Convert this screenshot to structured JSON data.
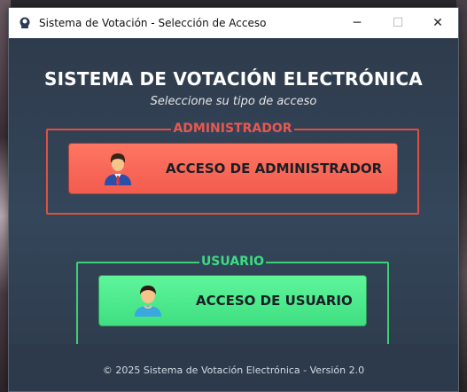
{
  "window": {
    "title": "Sistema de Votación - Selección de Acceso",
    "controls": {
      "minimize": "─",
      "maximize": "☐",
      "close": "✕"
    }
  },
  "header": {
    "title": "SISTEMA DE VOTACIÓN ELECTRÓNICA",
    "subtitle": "Seleccione su tipo de acceso"
  },
  "admin_group": {
    "legend": "ADMINISTRADOR",
    "button_label": "ACCESO DE ADMINISTRADOR",
    "icon": "admin-user-icon",
    "color": "#e04f41"
  },
  "user_group": {
    "legend": "USUARIO",
    "button_label": "ACCESO DE USUARIO",
    "icon": "user-icon",
    "color": "#3ecf75"
  },
  "footer": {
    "text": "© 2025 Sistema de Votación Electrónica - Versión 2.0"
  }
}
